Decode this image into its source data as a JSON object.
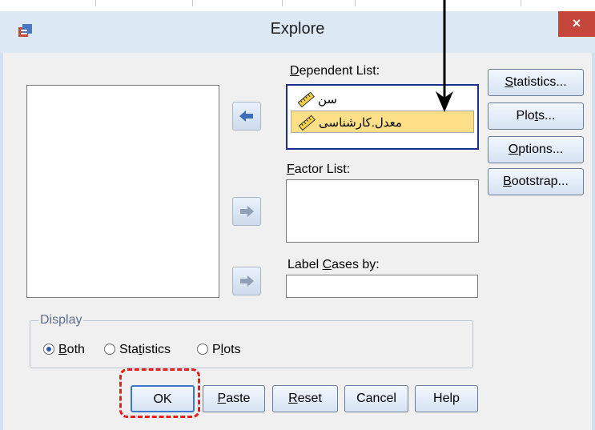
{
  "window": {
    "title": "Explore",
    "close_label": "×"
  },
  "dependent_list": {
    "label_prefix": "",
    "label_u": "D",
    "label_rest": "ependent List:",
    "items": [
      {
        "label": "سن",
        "icon": "ruler-icon",
        "selected": false
      },
      {
        "label": "معدل.کارشناسی",
        "icon": "ruler-icon",
        "selected": true
      }
    ]
  },
  "factor_list": {
    "label_u": "F",
    "label_rest": "actor List:"
  },
  "label_cases": {
    "label_pre": "Label ",
    "label_u": "C",
    "label_rest": "ases by:"
  },
  "side_buttons": {
    "statistics": {
      "u": "S",
      "rest": "tatistics..."
    },
    "plots": {
      "pre": "Plo",
      "u": "t",
      "rest": "s..."
    },
    "options": {
      "u": "O",
      "rest": "ptions..."
    },
    "bootstrap": {
      "u": "B",
      "rest": "ootstrap..."
    }
  },
  "display": {
    "legend": "Display",
    "options": {
      "both": {
        "u": "B",
        "rest": "oth",
        "checked": true
      },
      "statistics": {
        "pre": "Sta",
        "u": "t",
        "rest": "istics",
        "checked": false
      },
      "plots": {
        "pre": "P",
        "u": "l",
        "rest": "ots",
        "checked": false
      }
    }
  },
  "bottom_buttons": {
    "ok": "OK",
    "paste": {
      "u": "P",
      "rest": "aste"
    },
    "reset": {
      "u": "R",
      "rest": "eset"
    },
    "cancel": "Cancel",
    "help": "Help"
  },
  "colors": {
    "selection": "#fcdf86",
    "focus_border": "#1e2d8c",
    "highlight": "#e32020",
    "close": "#c7463b"
  }
}
